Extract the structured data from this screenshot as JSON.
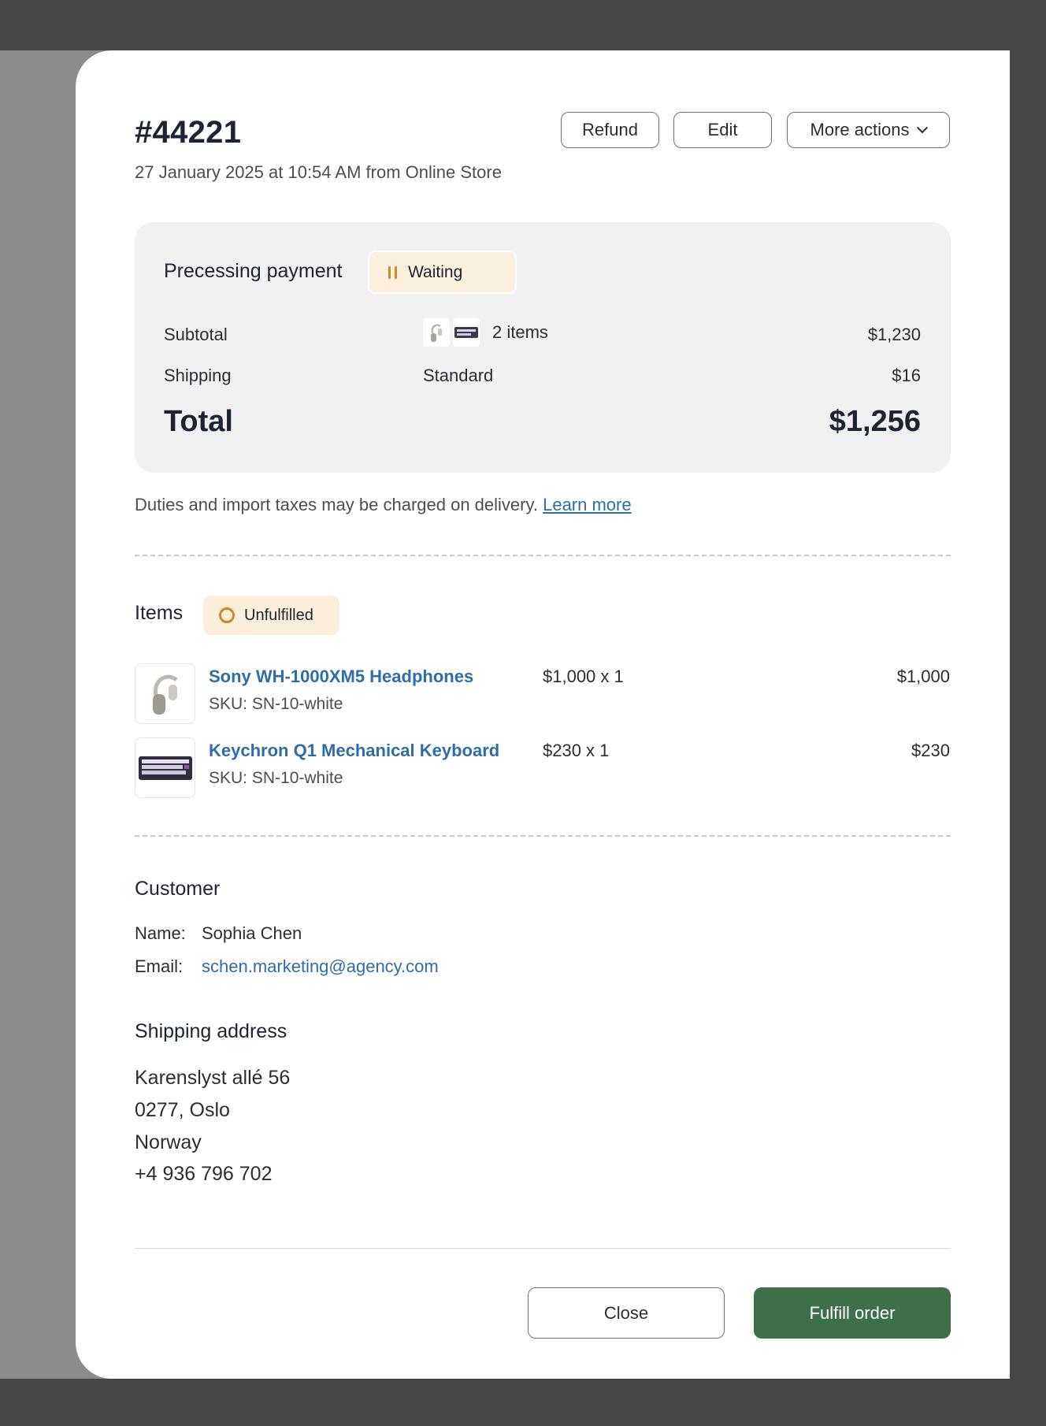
{
  "order": {
    "id": "#44221",
    "meta": "27 January 2025 at 10:54 AM from Online Store"
  },
  "header_actions": {
    "refund": "Refund",
    "edit": "Edit",
    "more_actions": "More actions"
  },
  "payment": {
    "title": "Precessing payment",
    "status": "Waiting",
    "subtotal_label": "Subtotal",
    "subtotal_items": "2 items",
    "subtotal_value": "$1,230",
    "shipping_label": "Shipping",
    "shipping_method": "Standard",
    "shipping_value": "$16",
    "total_label": "Total",
    "total_value": "$1,256"
  },
  "duties": {
    "text": "Duties and import taxes may be charged on delivery.",
    "link": "Learn more"
  },
  "items": {
    "title": "Items",
    "status": "Unfulfilled",
    "rows": [
      {
        "name": "Sony WH-1000XM5 Headphones",
        "sku": "SKU: SN-10-white",
        "qty": "$1,000 x 1",
        "total": "$1,000",
        "icon": "headphones-icon"
      },
      {
        "name": "Keychron Q1 Mechanical Keyboard",
        "sku": "SKU: SN-10-white",
        "qty": "$230 x 1",
        "total": "$230",
        "icon": "keyboard-icon"
      }
    ]
  },
  "customer": {
    "title": "Customer",
    "name_label": "Name:",
    "name": "Sophia Chen",
    "email_label": "Email:",
    "email": "schen.marketing@agency.com"
  },
  "shipping_address": {
    "title": "Shipping address",
    "lines": [
      "Karenslyst allé 56",
      "0277, Oslo",
      "Norway",
      "+4 936 796 702"
    ]
  },
  "footer": {
    "close": "Close",
    "fulfill": "Fulfill order"
  },
  "colors": {
    "accent_green": "#3d7048",
    "link_blue": "#2f6ca8",
    "badge_amber": "#c98a2a"
  }
}
